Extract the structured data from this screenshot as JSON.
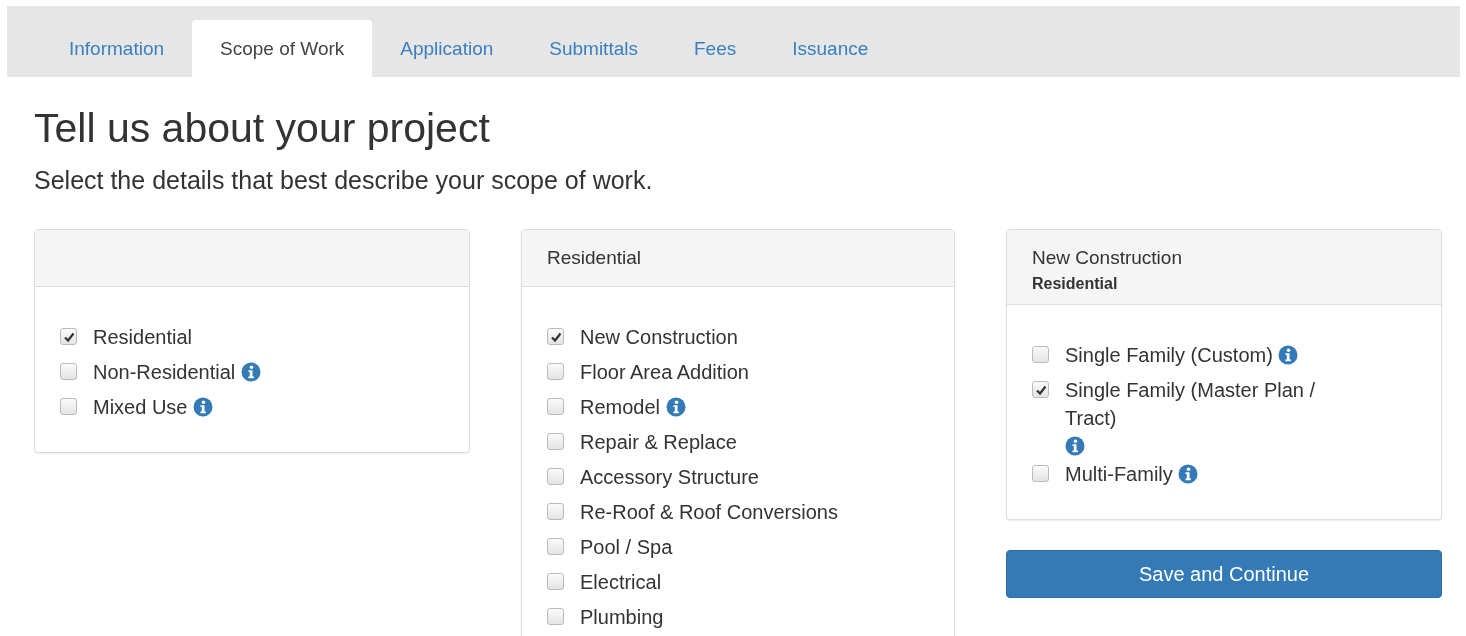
{
  "tabs": [
    {
      "label": "Information",
      "selected": false
    },
    {
      "label": "Scope of Work",
      "selected": true
    },
    {
      "label": "Application",
      "selected": false
    },
    {
      "label": "Submittals",
      "selected": false
    },
    {
      "label": "Fees",
      "selected": false
    },
    {
      "label": "Issuance",
      "selected": false
    }
  ],
  "heading": "Tell us about your project",
  "subheading": "Select the details that best describe your scope of work.",
  "panels": [
    {
      "options": [
        {
          "label": "Residential",
          "checked": true,
          "info": false
        },
        {
          "label": "Non-Residential",
          "checked": false,
          "info": true
        },
        {
          "label": "Mixed Use",
          "checked": false,
          "info": true
        }
      ]
    },
    {
      "title": "Residential",
      "options": [
        {
          "label": "New Construction",
          "checked": true,
          "info": false
        },
        {
          "label": "Floor Area Addition",
          "checked": false,
          "info": false
        },
        {
          "label": "Remodel",
          "checked": false,
          "info": true
        },
        {
          "label": "Repair & Replace",
          "checked": false,
          "info": false
        },
        {
          "label": "Accessory Structure",
          "checked": false,
          "info": false
        },
        {
          "label": "Re-Roof & Roof Conversions",
          "checked": false,
          "info": false
        },
        {
          "label": "Pool / Spa",
          "checked": false,
          "info": false
        },
        {
          "label": "Electrical",
          "checked": false,
          "info": false
        },
        {
          "label": "Plumbing",
          "checked": false,
          "info": false
        }
      ]
    },
    {
      "title": "New Construction",
      "subtitle": "Residential",
      "options": [
        {
          "label": "Single Family (Custom)",
          "checked": false,
          "info": true
        },
        {
          "label": "Single Family (Master Plan / Tract)",
          "checked": true,
          "info": true
        },
        {
          "label": "Multi-Family",
          "checked": false,
          "info": true
        }
      ]
    }
  ],
  "save_button": "Save and Continue"
}
